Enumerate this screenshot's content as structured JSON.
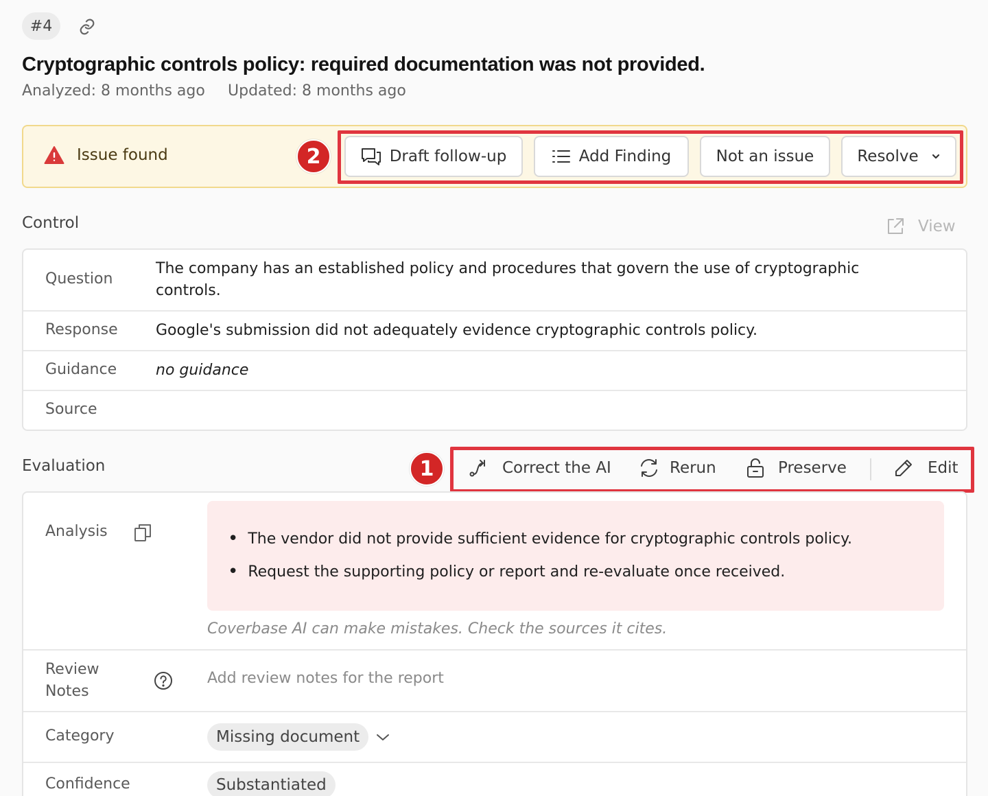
{
  "header": {
    "issue_number": "#4",
    "title": "Cryptographic controls policy: required documentation was not provided.",
    "analyzed": "Analyzed: 8 months ago",
    "updated": "Updated: 8 months ago"
  },
  "banner": {
    "status_text": "Issue found",
    "badge": "2",
    "actions": {
      "draft_followup": "Draft follow-up",
      "add_finding": "Add Finding",
      "not_an_issue": "Not an issue",
      "resolve": "Resolve"
    },
    "colors": {
      "background": "#fdf7e4",
      "border": "#f1d98c",
      "warning": "#d93a3a",
      "highlight": "#e0353f"
    }
  },
  "control": {
    "section_title": "Control",
    "view_label": "View",
    "rows": [
      {
        "label": "Question",
        "value_line1": "The company has an established policy and procedures that govern the use of cryptographic",
        "value_line2": "controls."
      },
      {
        "label": "Response",
        "value": "Google's submission did not adequately evidence cryptographic controls policy."
      },
      {
        "label": "Guidance",
        "value": "no guidance"
      },
      {
        "label": "Source",
        "value": ""
      }
    ]
  },
  "evaluation": {
    "section_title": "Evaluation",
    "badge": "1",
    "toolbar": {
      "correct_ai": "Correct the AI",
      "rerun": "Rerun",
      "preserve": "Preserve",
      "edit": "Edit"
    },
    "analysis_label": "Analysis",
    "analysis_points": [
      "The vendor did not provide sufficient evidence for cryptographic controls policy.",
      "Request the supporting policy or report and re-evaluate once received."
    ],
    "disclaimer": "Coverbase AI can make mistakes. Check the sources it cites.",
    "review_label_line1": "Review",
    "review_label_line2": "Notes",
    "review_placeholder": "Add review notes for the report",
    "category_label": "Category",
    "category_value": "Missing document",
    "confidence_label": "Confidence",
    "confidence_value": "Substantiated"
  }
}
